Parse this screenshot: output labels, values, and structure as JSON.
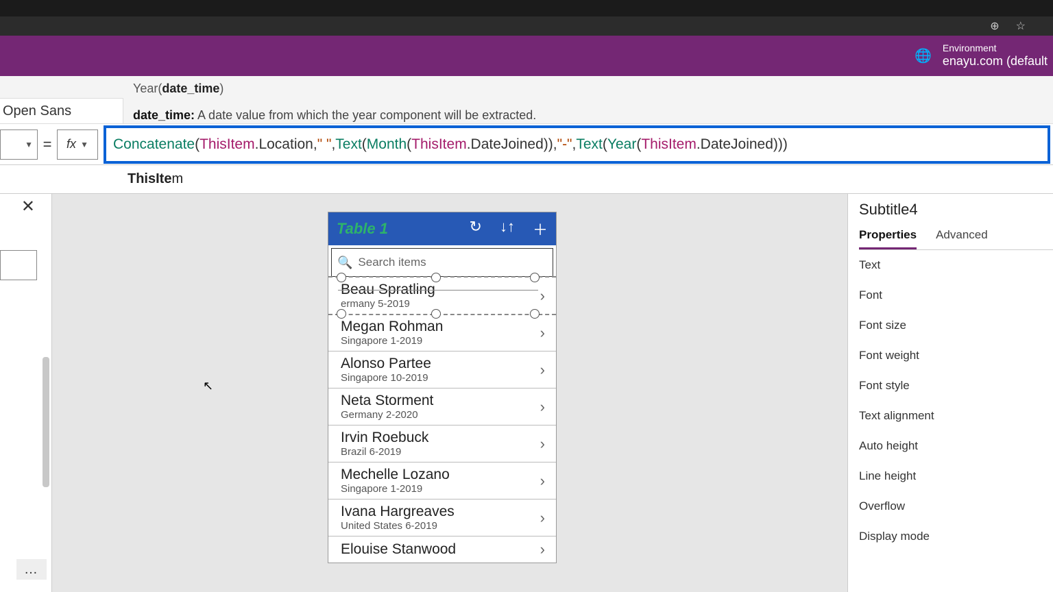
{
  "browser": {
    "zoom_icon": "⊕",
    "star_icon": "☆"
  },
  "header": {
    "env_label": "Environment",
    "env_value": "enayu.com (default"
  },
  "ribbon": {
    "font_name": "Open Sans",
    "signature_prefix": "Year(",
    "signature_param": "date_time",
    "signature_suffix": ")",
    "help_param": "date_time:",
    "help_text": " A date value from which the year component will be extracted."
  },
  "formula": {
    "fx": "fx",
    "tokens": {
      "concat": "Concatenate",
      "lp1": "(",
      "this1": "ThisItem",
      "loc": ".Location",
      "c1": ", ",
      "s1": "\" \"",
      "c2": ", ",
      "text1": "Text",
      "lp2": "(",
      "month": "Month",
      "lp3": "(",
      "this2": "ThisItem",
      "dj1": ".DateJoined",
      "rp1": "))",
      "c3": ", ",
      "s2": "\"-\"",
      "c4": ", ",
      "text2": "Text",
      "lp4": "(",
      "year": "Year",
      "lp5": "(",
      "this3": "ThisItem",
      "dj2": ".DateJoined",
      "rp2": ")))"
    }
  },
  "suggest": {
    "bold": "ThisIte",
    "rest": "m"
  },
  "gallery": {
    "title": "Table 1",
    "search_placeholder": "Search items",
    "items": [
      {
        "name": "Beau Spratling",
        "sub": "ermany 5-2019"
      },
      {
        "name": "Megan Rohman",
        "sub": "Singapore 1-2019"
      },
      {
        "name": "Alonso Partee",
        "sub": "Singapore 10-2019"
      },
      {
        "name": "Neta Storment",
        "sub": "Germany 2-2020"
      },
      {
        "name": "Irvin Roebuck",
        "sub": "Brazil 6-2019"
      },
      {
        "name": "Mechelle Lozano",
        "sub": "Singapore 1-2019"
      },
      {
        "name": "Ivana Hargreaves",
        "sub": "United States 6-2019"
      },
      {
        "name": "Elouise Stanwood",
        "sub": ""
      }
    ]
  },
  "props": {
    "title": "Subtitle4",
    "tab_props": "Properties",
    "tab_adv": "Advanced",
    "rows": [
      "Text",
      "Font",
      "Font size",
      "Font weight",
      "Font style",
      "Text alignment",
      "Auto height",
      "Line height",
      "Overflow",
      "Display mode"
    ]
  }
}
